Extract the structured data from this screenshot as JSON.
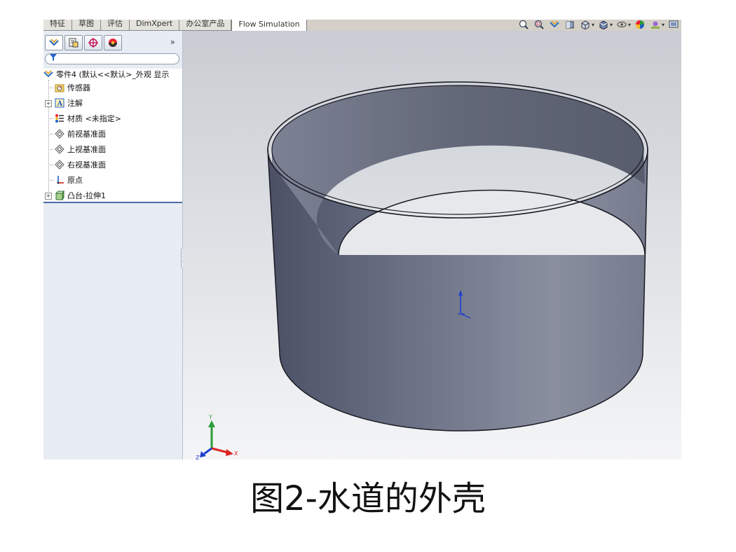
{
  "tabs": [
    "特征",
    "草图",
    "评估",
    "DimXpert",
    "办公室产品",
    "Flow Simulation"
  ],
  "active_tab": "Flow Simulation",
  "toolbar_icons": [
    "zoom-fit-icon",
    "zoom-area-icon",
    "previous-view-icon",
    "section-view-icon",
    "view-orientation-icon",
    "display-style-icon",
    "hide-show-icon",
    "appearance-icon",
    "scene-icon",
    "view-settings-icon"
  ],
  "panel": {
    "tab_icons": [
      "feature-manager-icon",
      "property-manager-icon",
      "configuration-manager-icon",
      "display-manager-icon"
    ],
    "more_label": "»"
  },
  "tree": {
    "root": "零件4  (默认<<默认>_外观 显示",
    "items": [
      {
        "label": "传感器",
        "icon": "sensor-folder-icon"
      },
      {
        "label": "注解",
        "icon": "annotation-icon"
      },
      {
        "label": "材质 <未指定>",
        "icon": "material-icon"
      },
      {
        "label": "前视基准面",
        "icon": "plane-icon"
      },
      {
        "label": "上视基准面",
        "icon": "plane-icon"
      },
      {
        "label": "右视基准面",
        "icon": "plane-icon"
      },
      {
        "label": "原点",
        "icon": "origin-icon"
      },
      {
        "label": "凸台-拉伸1",
        "icon": "extrude-feature-icon"
      }
    ]
  },
  "triad": {
    "x": "X",
    "y": "Y",
    "z": "Z"
  },
  "caption": "图2-水道的外壳"
}
